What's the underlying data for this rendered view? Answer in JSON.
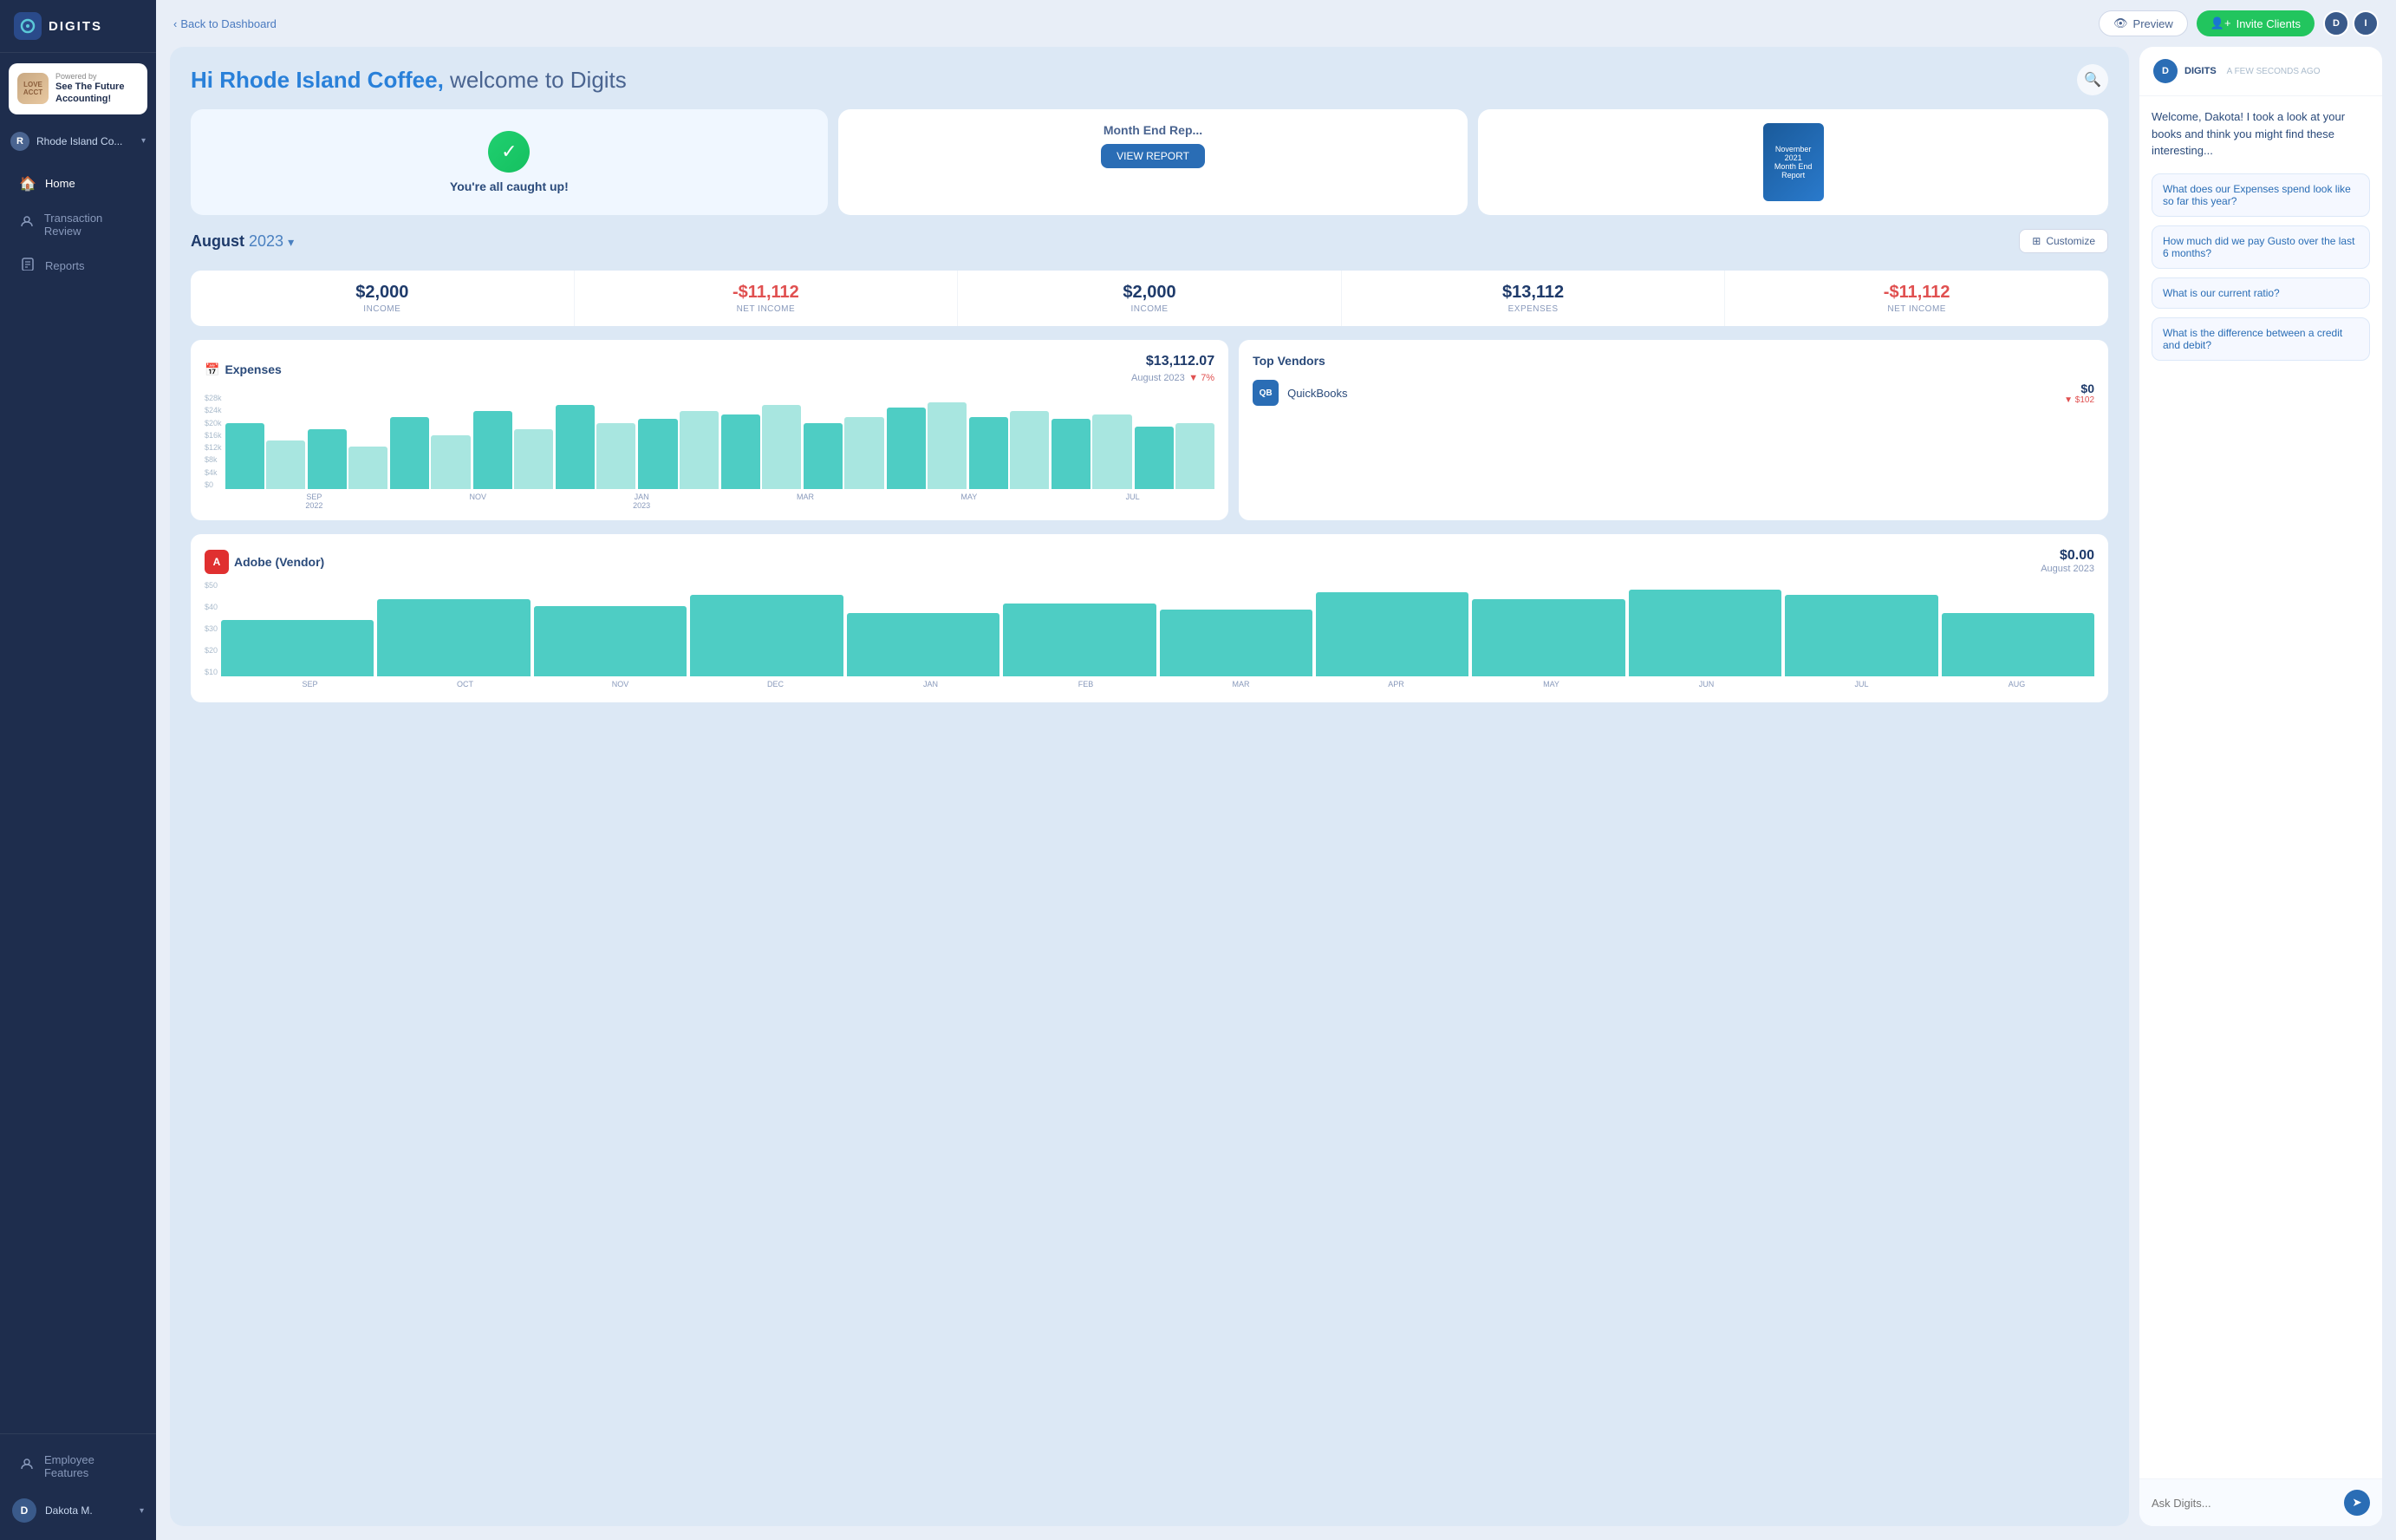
{
  "app": {
    "logo_text": "DIGITS",
    "logo_icon": "D"
  },
  "sidebar": {
    "powered_by": "Powered by",
    "powered_title": "See The Future Accounting!",
    "company_initial": "R",
    "company_name": "Rhode Island Co...",
    "nav": [
      {
        "id": "home",
        "label": "Home",
        "icon": "🏠",
        "active": true
      },
      {
        "id": "transaction-review",
        "label": "Transaction Review",
        "icon": "👤"
      },
      {
        "id": "reports",
        "label": "Reports",
        "icon": "📄"
      }
    ],
    "employee_features": "Employee Features",
    "user_initial": "D",
    "user_name": "Dakota M."
  },
  "topbar": {
    "back_label": "Back to Dashboard",
    "preview_label": "Preview",
    "invite_label": "Invite Clients",
    "user_initial_1": "D",
    "user_initial_2": "I"
  },
  "welcome": {
    "greeting": "Hi Rhode Island Coffee,",
    "subtitle": "welcome to Digits",
    "search_title": "Search"
  },
  "cards": {
    "caught_up": {
      "title": "You're all caught up!"
    },
    "month_end_report": {
      "title": "Month End Rep...",
      "view_label": "VIEW REPORT",
      "book_line1": "November",
      "book_line2": "2021",
      "book_line3": "Month End",
      "book_line4": "Report"
    }
  },
  "period": {
    "month": "August",
    "year": "2023",
    "customize_label": "Customize"
  },
  "stats": [
    {
      "value": "$2,000",
      "label": "INCOME",
      "negative": false
    },
    {
      "value": "-$11,112",
      "label": "NET INCOME",
      "negative": true
    },
    {
      "value": "$2,000",
      "label": "INCOME",
      "negative": false
    },
    {
      "value": "$13,112",
      "label": "EXPENSES",
      "negative": false
    },
    {
      "value": "-$11,112",
      "label": "NET INCOME",
      "negative": true
    }
  ],
  "expenses": {
    "title": "Expenses",
    "icon": "📅",
    "amount": "$13,112.07",
    "period": "August 2023",
    "change": "▼ 7%",
    "y_labels": [
      "$28k",
      "$24k",
      "$20k",
      "$16k",
      "$12k",
      "$8k",
      "$4k",
      "$0"
    ],
    "x_labels": [
      "SEP\n2022",
      "NOV",
      "JAN\n2023",
      "MAR",
      "MAY",
      "JUL"
    ],
    "bars": [
      {
        "main": 55,
        "light": 40
      },
      {
        "main": 50,
        "light": 35
      },
      {
        "main": 60,
        "light": 45
      },
      {
        "main": 65,
        "light": 50
      },
      {
        "main": 70,
        "light": 55
      },
      {
        "main": 58,
        "light": 65
      },
      {
        "main": 62,
        "light": 70
      },
      {
        "main": 55,
        "light": 60
      },
      {
        "main": 68,
        "light": 72
      },
      {
        "main": 60,
        "light": 65
      },
      {
        "main": 58,
        "light": 62
      },
      {
        "main": 52,
        "light": 55
      }
    ]
  },
  "vendors": {
    "title": "Top Vendors",
    "items": [
      {
        "name": "QuickBooks",
        "icon": "QB",
        "color": "#2a6db5",
        "amount": "$0",
        "change": "▼ $102"
      }
    ]
  },
  "adobe": {
    "icon": "A",
    "title": "Adobe (Vendor)",
    "period": "August 2023",
    "amount": "$0.00",
    "y_labels": [
      "$50",
      "$40",
      "$30",
      "$20",
      "$10"
    ],
    "x_labels": [
      "SEP",
      "OCT",
      "NOV",
      "DEC",
      "JAN",
      "FEB",
      "MAR",
      "APR",
      "MAY",
      "JUN",
      "JUL",
      "AUG"
    ],
    "bars": [
      40,
      55,
      50,
      58,
      45,
      52,
      48,
      60,
      55,
      62,
      58,
      45
    ]
  },
  "chat": {
    "sender": "DIGITS",
    "time": "A FEW SECONDS AGO",
    "intro": "Welcome, Dakota! I took a look at your books and think you might find these interesting...",
    "suggestions": [
      "What does our Expenses spend look like so far this year?",
      "How much did we pay Gusto over the last 6 months?",
      "What is our current ratio?",
      "What is the difference between a credit and debit?"
    ],
    "input_placeholder": "Ask Digits..."
  }
}
